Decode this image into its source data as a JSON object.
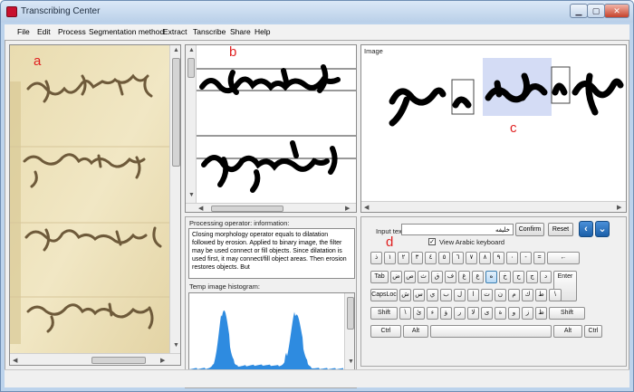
{
  "window": {
    "title": "Transcribing Center"
  },
  "menu": [
    "File",
    "Edit",
    "Process",
    "Segmentation method",
    "Extract",
    "Tanscribe",
    "Share",
    "Help"
  ],
  "markers": {
    "a": "a",
    "b": "b",
    "c": "c",
    "d": "d"
  },
  "image_panel": {
    "label": "Image"
  },
  "processing": {
    "label": "Processing operator: information:",
    "text": "Closing morphology operator equals to dilatation followed by erosion.  Applied to binary image, the filter may be used connect or fill objects. Since dilatation is used first, it may connect/fill object areas. Then erosion restores objects. But"
  },
  "histogram": {
    "label": "Temp image histogram:",
    "color": "#2e8be0"
  },
  "keyboard": {
    "input_label": "Input text:",
    "input_value": "خليفه",
    "confirm": "Confirm",
    "reset": "Reset",
    "view_arabic_label": "View Arabic keyboard",
    "view_arabic_checked": "✓",
    "nav_left": "‹",
    "nav_down": "⌄",
    "rows": [
      [
        "ذ",
        "١",
        "٢",
        "٣",
        "٤",
        "٥",
        "٦",
        "٧",
        "٨",
        "٩",
        "٠",
        "-",
        "=",
        "←"
      ],
      [
        "Tab",
        "ض",
        "ص",
        "ث",
        "ق",
        "ف",
        "غ",
        "ع",
        "ه",
        "خ",
        "ح",
        "ج",
        "د",
        "Enter"
      ],
      [
        "CapsLoc",
        "ش",
        "س",
        "ي",
        "ب",
        "ل",
        "ا",
        "ت",
        "ن",
        "م",
        "ك",
        "ط",
        "\\"
      ],
      [
        "Shift",
        "\\",
        "ئ",
        "ء",
        "ؤ",
        "ر",
        "لا",
        "ى",
        "ة",
        "و",
        "ز",
        "ظ",
        "Shift"
      ],
      [
        "Ctrl",
        "Alt",
        "",
        "Alt",
        "Ctrl"
      ]
    ],
    "highlighted_key": "ه"
  },
  "scroll_arrows": {
    "up": "▲",
    "down": "▼",
    "left": "◀",
    "right": "▶"
  }
}
